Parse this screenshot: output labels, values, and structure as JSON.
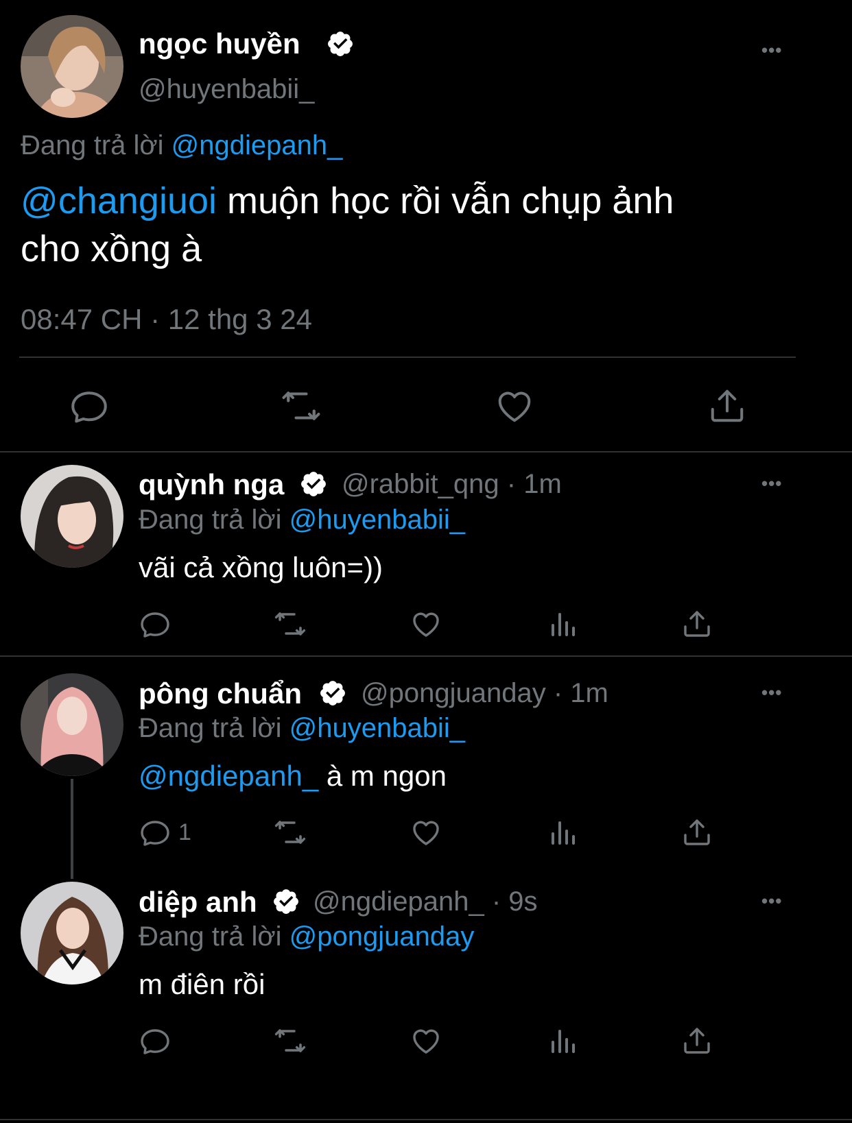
{
  "main_tweet": {
    "display_name": "ngọc huyền",
    "handle": "@huyenbabii_",
    "replying_prefix": "Đang trả lời",
    "replying_to": "@ngdiepanh_",
    "mention": "@changiuoi",
    "text_line1": " muộn học rồi vẫn chụp ảnh",
    "text_line2": "cho xồng à",
    "timestamp": "08:47 CH · 12 thg 3 24",
    "more_label": "•••"
  },
  "replies": [
    {
      "display_name": "quỳnh nga",
      "handle": "@rabbit_qng · 1m",
      "replying_prefix": "Đang trả lời",
      "replying_to": "@huyenbabii_",
      "mention": "",
      "text": "vãi cả xồng luôn=))",
      "reply_count": "",
      "more_label": "•••"
    },
    {
      "display_name": "pông chuẩn",
      "handle": "@pongjuanday · 1m",
      "replying_prefix": "Đang trả lời",
      "replying_to": "@huyenbabii_",
      "mention": "@ngdiepanh_",
      "text": " à m ngon",
      "reply_count": "1",
      "more_label": "•••"
    },
    {
      "display_name": "diệp anh",
      "handle": "@ngdiepanh_ · 9s",
      "replying_prefix": "Đang trả lời",
      "replying_to": "@pongjuanday",
      "mention": "",
      "text": "m điên rồi",
      "reply_count": "",
      "more_label": "•••"
    }
  ],
  "icons": {
    "reply": "reply-icon",
    "retweet": "retweet-icon",
    "like": "heart-icon",
    "views": "views-icon",
    "share": "share-icon",
    "verified": "verified-badge-icon",
    "more": "more-icon"
  },
  "colors": {
    "background": "#000000",
    "text": "#ffffff",
    "muted": "#71767b",
    "link": "#1d9bf0",
    "divider": "#2f3336"
  }
}
